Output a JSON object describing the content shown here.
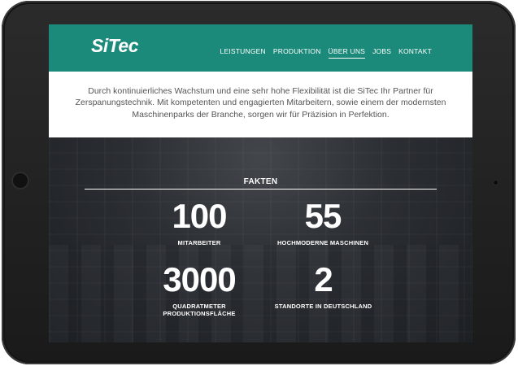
{
  "brand": {
    "logo_text": "SiTec",
    "accent_color": "#1c8a7a"
  },
  "nav": {
    "items": [
      {
        "label": "LEISTUNGEN",
        "active": false
      },
      {
        "label": "PRODUKTION",
        "active": false
      },
      {
        "label": "ÜBER UNS",
        "active": true
      },
      {
        "label": "JOBS",
        "active": false
      },
      {
        "label": "KONTAKT",
        "active": false
      }
    ]
  },
  "intro": {
    "text": "Durch kontinuierliches Wachstum und eine sehr hohe Flexibilität ist die SiTec Ihr Partner für Zerspanungstechnik. Mit kompetenten und engagierten Mitarbeitern, sowie einem der modernsten Maschinenparks der Branche, sorgen wir für Präzision in Perfektion."
  },
  "facts": {
    "title": "FAKTEN",
    "stats": [
      {
        "value": "100",
        "label": "MITARBEITER"
      },
      {
        "value": "55",
        "label": "HOCHMODERNE MASCHINEN"
      },
      {
        "value": "3000",
        "label": "QUADRATMETER PRODUKTIONSFLÄCHE"
      },
      {
        "value": "2",
        "label": "STANDORTE IN DEUTSCHLAND"
      }
    ]
  }
}
